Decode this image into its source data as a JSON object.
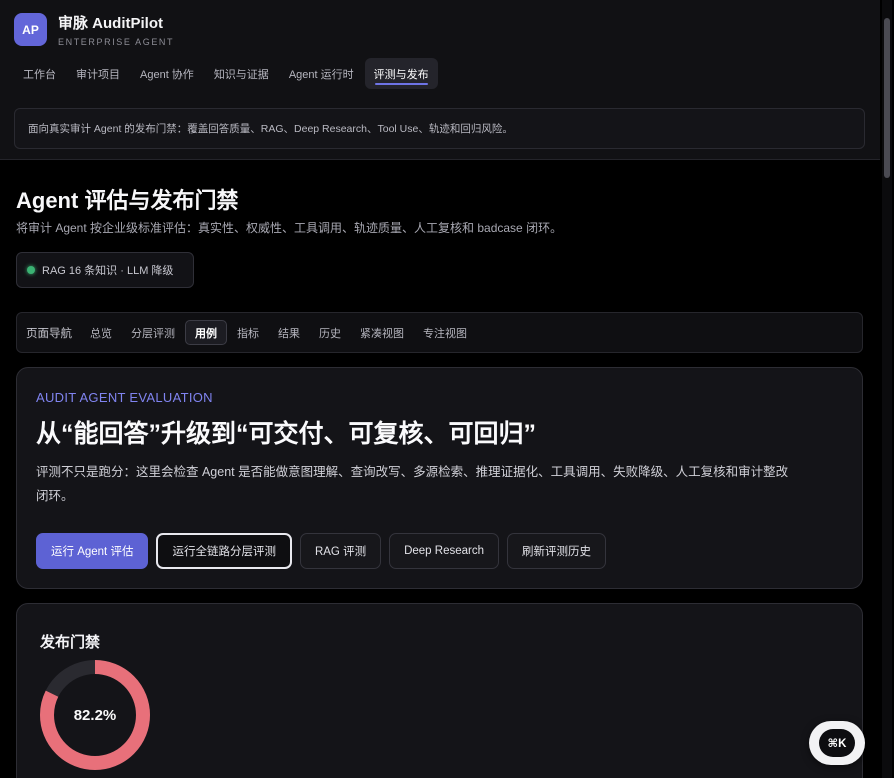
{
  "brand": {
    "logo": "AP",
    "name": "审脉 AuditPilot",
    "subtitle": "ENTERPRISE AGENT"
  },
  "nav": {
    "tabs": [
      "工作台",
      "审计项目",
      "Agent 协作",
      "知识与证据",
      "Agent 运行时",
      "评测与发布"
    ],
    "active": "评测与发布"
  },
  "notice": "面向真实审计 Agent 的发布门禁：覆盖回答质量、RAG、Deep Research、Tool Use、轨迹和回归风险。",
  "page": {
    "title": "Agent 评估与发布门禁",
    "subtitle": "将审计 Agent 按企业级标准评估：真实性、权威性、工具调用、轨迹质量、人工复核和 badcase 闭环。"
  },
  "status": {
    "text": "RAG 16 条知识 · LLM 降级",
    "color": "#3bb273"
  },
  "subnav": {
    "label": "页面导航",
    "tabs": [
      "总览",
      "分层评测",
      "用例",
      "指标",
      "结果",
      "历史",
      "紧凑视图",
      "专注视图"
    ],
    "active": "用例"
  },
  "hero": {
    "eyebrow": "AUDIT AGENT EVALUATION",
    "headline": "从“能回答”升级到“可交付、可复核、可回归”",
    "description": "评测不只是跑分：这里会检查 Agent 是否能做意图理解、查询改写、多源检索、推理证据化、工具调用、失败降级、人工复核和审计整改闭环。",
    "buttons": {
      "run_eval": "运行 Agent 评估",
      "run_layered": "运行全链路分层评测",
      "rag_eval": "RAG 评测",
      "deep_research": "Deep Research",
      "refresh_history": "刷新评测历史"
    }
  },
  "gate": {
    "title": "发布门禁",
    "score_label": "82.2%",
    "score_value": 0.822,
    "ring_color": "#e8707a",
    "track_color": "#2a2a30"
  },
  "shortcut": {
    "label": "⌘K"
  },
  "colors": {
    "accent": "#5d62d4",
    "eyebrow": "#8084f0"
  }
}
